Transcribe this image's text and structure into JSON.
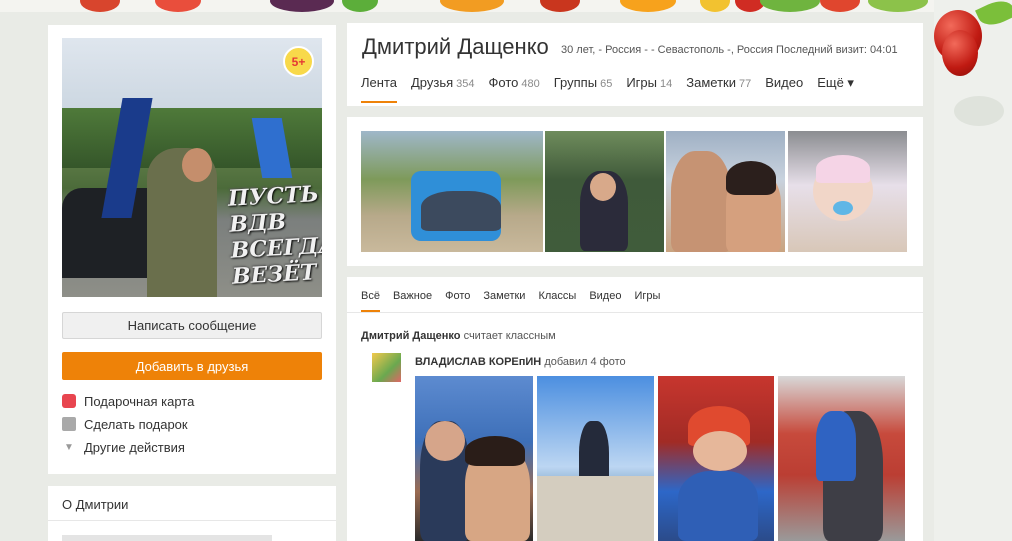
{
  "profile": {
    "name": "Дмитрий Дащенко",
    "meta": "30 лет, - Россия - - Севастополь -, Россия Последний визит: 04:01",
    "badge": "5+",
    "avatar_caption": "ПУСТЬ ВДВ ВСЕГДА ВЕЗЁТ"
  },
  "tabs": [
    {
      "label": "Лента",
      "count": ""
    },
    {
      "label": "Друзья",
      "count": "354"
    },
    {
      "label": "Фото",
      "count": "480"
    },
    {
      "label": "Группы",
      "count": "65"
    },
    {
      "label": "Игры",
      "count": "14"
    },
    {
      "label": "Заметки",
      "count": "77"
    },
    {
      "label": "Видео",
      "count": ""
    },
    {
      "label": "Ещё ▾",
      "count": ""
    }
  ],
  "buttons": {
    "message": "Написать сообщение",
    "add_friend": "Добавить в друзья"
  },
  "actions": [
    {
      "label": "Подарочная карта",
      "icon": "gift-card-icon"
    },
    {
      "label": "Сделать подарок",
      "icon": "gift-icon"
    },
    {
      "label": "Другие действия",
      "icon": "caret-down-icon"
    }
  ],
  "about": {
    "title": "О Дмитрии"
  },
  "feed_tabs": [
    "Всё",
    "Важное",
    "Фото",
    "Заметки",
    "Классы",
    "Видео",
    "Игры"
  ],
  "feed": {
    "actor": "Дмитрий Дащенко",
    "action": "считает классным",
    "post_author": "ВЛАДИСЛАВ КОРЕпИН",
    "post_action": "добавил 4 фото"
  },
  "colors": {
    "accent": "#ee8208",
    "background": "#e9ebe6",
    "badge_bg": "#f8d94a",
    "badge_text": "#e53935"
  }
}
